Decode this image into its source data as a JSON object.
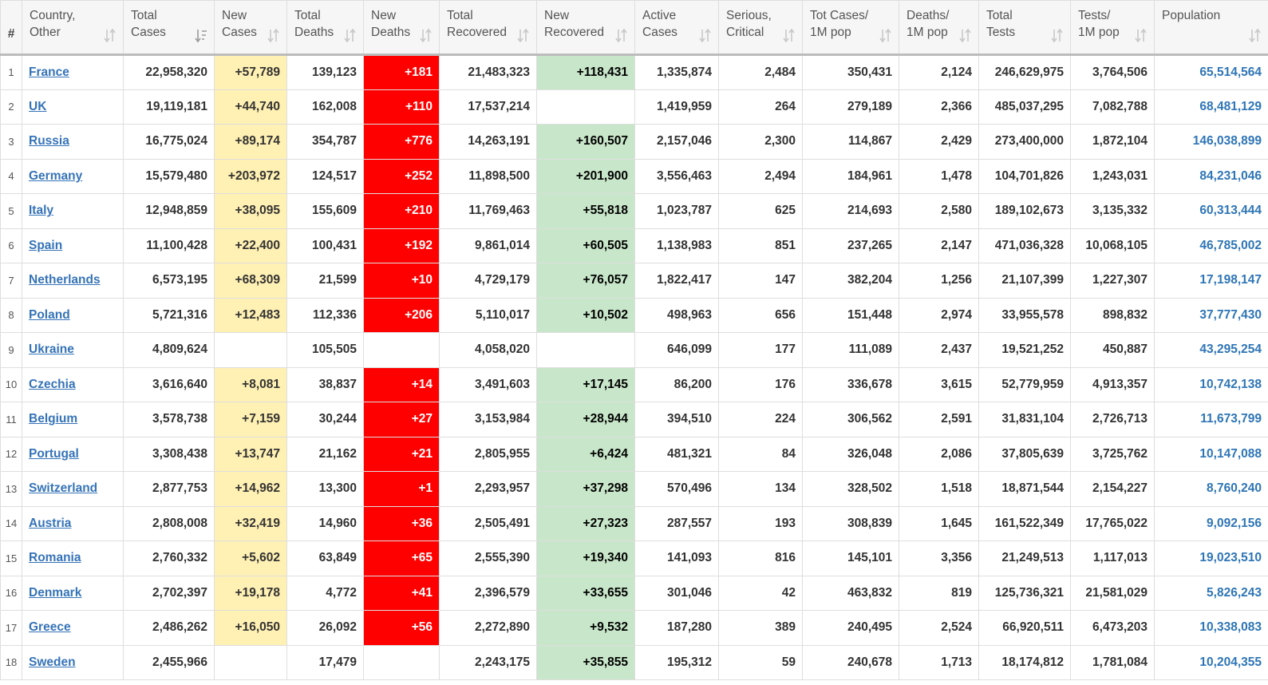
{
  "columns": [
    {
      "line1": "#",
      "line2": ""
    },
    {
      "line1": "Country,",
      "line2": "Other"
    },
    {
      "line1": "Total",
      "line2": "Cases"
    },
    {
      "line1": "New",
      "line2": "Cases"
    },
    {
      "line1": "Total",
      "line2": "Deaths"
    },
    {
      "line1": "New",
      "line2": "Deaths"
    },
    {
      "line1": "Total",
      "line2": "Recovered"
    },
    {
      "line1": "New",
      "line2": "Recovered"
    },
    {
      "line1": "Active",
      "line2": "Cases"
    },
    {
      "line1": "Serious,",
      "line2": "Critical"
    },
    {
      "line1": "Tot Cases/",
      "line2": "1M pop"
    },
    {
      "line1": "Deaths/",
      "line2": "1M pop"
    },
    {
      "line1": "Total",
      "line2": "Tests"
    },
    {
      "line1": "Tests/",
      "line2": "1M pop"
    },
    {
      "line1": "Population",
      "line2": ""
    }
  ],
  "colors": {
    "new_cases_bg": "#fff0b3",
    "new_deaths_bg": "#ff0000",
    "new_recovered_bg": "#c8e6c9",
    "link": "#3573b8",
    "population": "#2e75b6"
  },
  "rows": [
    [
      "1",
      "France",
      "22,958,320",
      "+57,789",
      "139,123",
      "+181",
      "21,483,323",
      "+118,431",
      "1,335,874",
      "2,484",
      "350,431",
      "2,124",
      "246,629,975",
      "3,764,506",
      "65,514,564"
    ],
    [
      "2",
      "UK",
      "19,119,181",
      "+44,740",
      "162,008",
      "+110",
      "17,537,214",
      "",
      "1,419,959",
      "264",
      "279,189",
      "2,366",
      "485,037,295",
      "7,082,788",
      "68,481,129"
    ],
    [
      "3",
      "Russia",
      "16,775,024",
      "+89,174",
      "354,787",
      "+776",
      "14,263,191",
      "+160,507",
      "2,157,046",
      "2,300",
      "114,867",
      "2,429",
      "273,400,000",
      "1,872,104",
      "146,038,899"
    ],
    [
      "4",
      "Germany",
      "15,579,480",
      "+203,972",
      "124,517",
      "+252",
      "11,898,500",
      "+201,900",
      "3,556,463",
      "2,494",
      "184,961",
      "1,478",
      "104,701,826",
      "1,243,031",
      "84,231,046"
    ],
    [
      "5",
      "Italy",
      "12,948,859",
      "+38,095",
      "155,609",
      "+210",
      "11,769,463",
      "+55,818",
      "1,023,787",
      "625",
      "214,693",
      "2,580",
      "189,102,673",
      "3,135,332",
      "60,313,444"
    ],
    [
      "6",
      "Spain",
      "11,100,428",
      "+22,400",
      "100,431",
      "+192",
      "9,861,014",
      "+60,505",
      "1,138,983",
      "851",
      "237,265",
      "2,147",
      "471,036,328",
      "10,068,105",
      "46,785,002"
    ],
    [
      "7",
      "Netherlands",
      "6,573,195",
      "+68,309",
      "21,599",
      "+10",
      "4,729,179",
      "+76,057",
      "1,822,417",
      "147",
      "382,204",
      "1,256",
      "21,107,399",
      "1,227,307",
      "17,198,147"
    ],
    [
      "8",
      "Poland",
      "5,721,316",
      "+12,483",
      "112,336",
      "+206",
      "5,110,017",
      "+10,502",
      "498,963",
      "656",
      "151,448",
      "2,974",
      "33,955,578",
      "898,832",
      "37,777,430"
    ],
    [
      "9",
      "Ukraine",
      "4,809,624",
      "",
      "105,505",
      "",
      "4,058,020",
      "",
      "646,099",
      "177",
      "111,089",
      "2,437",
      "19,521,252",
      "450,887",
      "43,295,254"
    ],
    [
      "10",
      "Czechia",
      "3,616,640",
      "+8,081",
      "38,837",
      "+14",
      "3,491,603",
      "+17,145",
      "86,200",
      "176",
      "336,678",
      "3,615",
      "52,779,959",
      "4,913,357",
      "10,742,138"
    ],
    [
      "11",
      "Belgium",
      "3,578,738",
      "+7,159",
      "30,244",
      "+27",
      "3,153,984",
      "+28,944",
      "394,510",
      "224",
      "306,562",
      "2,591",
      "31,831,104",
      "2,726,713",
      "11,673,799"
    ],
    [
      "12",
      "Portugal",
      "3,308,438",
      "+13,747",
      "21,162",
      "+21",
      "2,805,955",
      "+6,424",
      "481,321",
      "84",
      "326,048",
      "2,086",
      "37,805,639",
      "3,725,762",
      "10,147,088"
    ],
    [
      "13",
      "Switzerland",
      "2,877,753",
      "+14,962",
      "13,300",
      "+1",
      "2,293,957",
      "+37,298",
      "570,496",
      "134",
      "328,502",
      "1,518",
      "18,871,544",
      "2,154,227",
      "8,760,240"
    ],
    [
      "14",
      "Austria",
      "2,808,008",
      "+32,419",
      "14,960",
      "+36",
      "2,505,491",
      "+27,323",
      "287,557",
      "193",
      "308,839",
      "1,645",
      "161,522,349",
      "17,765,022",
      "9,092,156"
    ],
    [
      "15",
      "Romania",
      "2,760,332",
      "+5,602",
      "63,849",
      "+65",
      "2,555,390",
      "+19,340",
      "141,093",
      "816",
      "145,101",
      "3,356",
      "21,249,513",
      "1,117,013",
      "19,023,510"
    ],
    [
      "16",
      "Denmark",
      "2,702,397",
      "+19,178",
      "4,772",
      "+41",
      "2,396,579",
      "+33,655",
      "301,046",
      "42",
      "463,832",
      "819",
      "125,736,321",
      "21,581,029",
      "5,826,243"
    ],
    [
      "17",
      "Greece",
      "2,486,262",
      "+16,050",
      "26,092",
      "+56",
      "2,272,890",
      "+9,532",
      "187,280",
      "389",
      "240,495",
      "2,524",
      "66,920,511",
      "6,473,203",
      "10,338,083"
    ],
    [
      "18",
      "Sweden",
      "2,455,966",
      "",
      "17,479",
      "",
      "2,243,175",
      "+35,855",
      "195,312",
      "59",
      "240,678",
      "1,713",
      "18,174,812",
      "1,781,084",
      "10,204,355"
    ]
  ]
}
